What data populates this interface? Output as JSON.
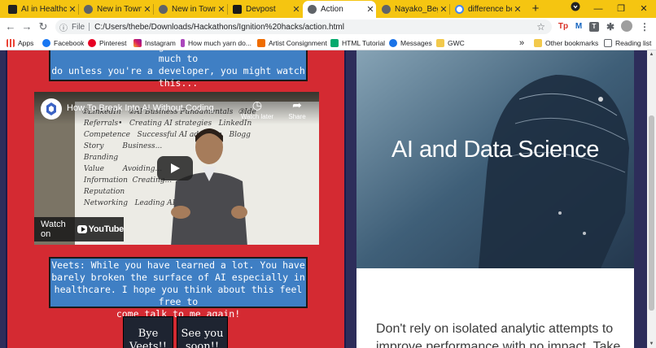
{
  "browser": {
    "tabs": [
      {
        "title": "AI in Healthcare"
      },
      {
        "title": "New in Town: D"
      },
      {
        "title": "New in Town: D"
      },
      {
        "title": "Devpost"
      },
      {
        "title": "Action"
      },
      {
        "title": "Nayako_Begin"
      },
      {
        "title": "difference betw"
      }
    ],
    "active_tab_index": 4,
    "new_tab_symbol": "+",
    "address": {
      "protocol_label": "File",
      "url": "C:/Users/thebe/Downloads/Hackathons/Ignition%20hacks/action.html"
    },
    "bookmarks": [
      {
        "label": "Apps",
        "icon": "apps-grid-icon"
      },
      {
        "label": "Facebook",
        "icon": "facebook-icon"
      },
      {
        "label": "Pinterest",
        "icon": "pinterest-icon"
      },
      {
        "label": "Instagram",
        "icon": "instagram-icon"
      },
      {
        "label": "How much yarn do...",
        "icon": "yarn-icon"
      },
      {
        "label": "Artist Consignment",
        "icon": "artist-icon"
      },
      {
        "label": "HTML Tutorial",
        "icon": "w3schools-icon"
      },
      {
        "label": "Messages",
        "icon": "messages-icon"
      },
      {
        "label": "GWC",
        "icon": "folder-icon"
      }
    ],
    "bookmarks_overflow": "»",
    "other_bookmarks": "Other bookmarks",
    "reading_list": "Reading list",
    "accent_color": "#f5c511"
  },
  "page": {
    "top_message": {
      "line1": "Veets: While it might seem like there isn't much to",
      "line2": "do unless you're a developer, you might watch",
      "line3": "this..."
    },
    "video": {
      "title": "How To Break Into AI Without Coding",
      "watch_later": "Watch later",
      "share": "Share",
      "watch_on": "Watch on",
      "platform": "YouTube"
    },
    "bottom_message": {
      "line1": "Veets: While you have learned a lot. You have",
      "line2": "barely broken the surface of AI especially in",
      "line3": "healthcare. I hope you think about this feel free to",
      "line4": "come talk to me again!"
    },
    "buttons": [
      {
        "line1": "Bye",
        "line2": "Veets!!"
      },
      {
        "line1": "See you",
        "line2": "soon!!"
      }
    ],
    "hero": {
      "title": "AI and Data Science"
    },
    "description": {
      "line1": "Don't rely on isolated analytic attempts to",
      "line2": "improve performance with no impact. Take"
    },
    "colors": {
      "left_panel": "#d42a32",
      "message_box": "#3f7fc4",
      "page_background": "#2d2d5a"
    }
  }
}
